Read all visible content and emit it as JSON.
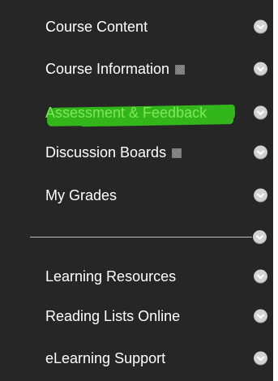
{
  "menu": {
    "items": [
      {
        "label": "Course Content",
        "has_box_icon": false,
        "chevron": "chevron-down-icon"
      },
      {
        "label": "Course Information",
        "has_box_icon": true,
        "chevron": "chevron-down-icon"
      },
      {
        "label": "Assessment & Feedback",
        "has_box_icon": false,
        "highlighted": true,
        "chevron": "chevron-down-icon"
      },
      {
        "label": "Discussion Boards",
        "has_box_icon": true,
        "chevron": "chevron-down-icon"
      },
      {
        "label": "My Grades",
        "has_box_icon": false,
        "chevron": "chevron-down-icon"
      }
    ],
    "lower_items": [
      {
        "label": "Learning Resources",
        "chevron": "chevron-down-icon"
      },
      {
        "label": "Reading Lists Online",
        "chevron": "chevron-down-icon"
      },
      {
        "label": "eLearning Support",
        "chevron": "chevron-down-icon"
      }
    ]
  },
  "colors": {
    "background": "#262626",
    "text": "#ffffff",
    "highlight_marker": "#33b51c",
    "chevron_circle": "#d2d2d2"
  }
}
